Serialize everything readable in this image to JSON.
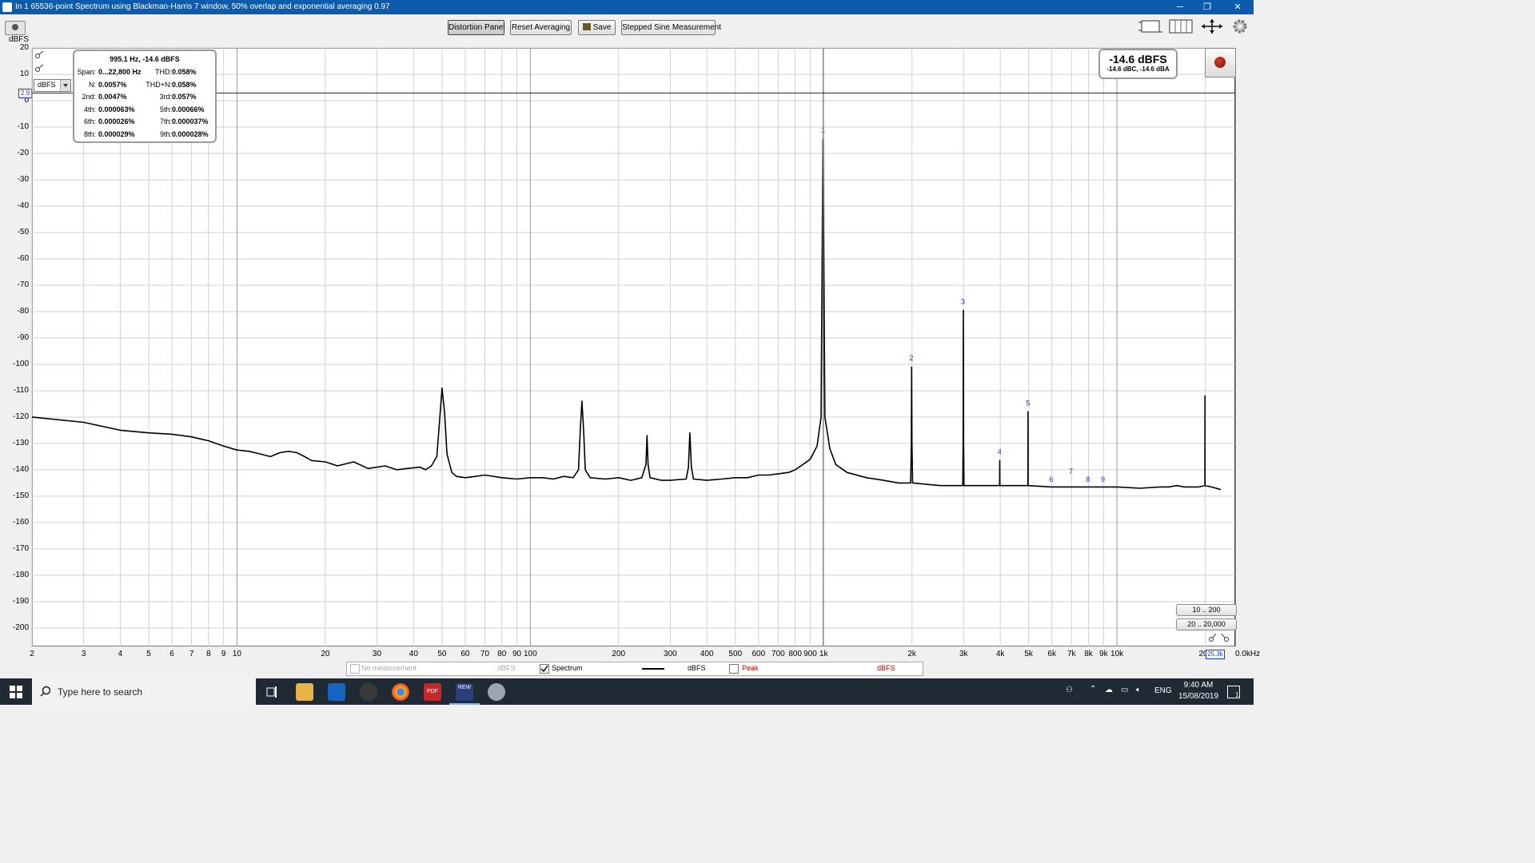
{
  "window": {
    "title": "In 1 65536-point Spectrum using Blackman-Harris 7 window, 50% overlap and exponential averaging 0.97",
    "controls": {
      "minimize": "─",
      "maximize": "❐",
      "close": "✕"
    }
  },
  "toolbar": {
    "buttons": {
      "distortion_panel": "Distortion Panel",
      "reset_averaging": "Reset Averaging",
      "save": "Save",
      "stepped_sine": "Stepped Sine Measurement"
    }
  },
  "distortion_panel": {
    "header": "995.1 Hz, -14.6 dBFS",
    "rows": [
      {
        "k1": "Span:",
        "v1": "0...22,800 Hz",
        "k2": "THD:",
        "v2": "0.058%"
      },
      {
        "k1": "N:",
        "v1": "0.0057%",
        "k2": "THD+N:",
        "v2": "0.058%"
      },
      {
        "k1": "2nd:",
        "v1": "0.0047%",
        "k2": "3rd:",
        "v2": "0.057%"
      },
      {
        "k1": "4th:",
        "v1": "0.000063%",
        "k2": "5th:",
        "v2": "0.00066%"
      },
      {
        "k1": "6th:",
        "v1": "0.000026%",
        "k2": "7th:",
        "v2": "0.000037%"
      },
      {
        "k1": "8th:",
        "v1": "0.000029%",
        "k2": "9th:",
        "v2": "0.000028%"
      }
    ]
  },
  "level_meter": {
    "main": "-14.6 dBFS",
    "sub": "-14.6 dBC, -14.6 dBA"
  },
  "y_axis": {
    "unit_label": "dBFS",
    "unit_select": "dBFS",
    "cursor_value": "2.9",
    "labels": [
      "20",
      "10",
      "0",
      "-10",
      "-20",
      "-30",
      "-40",
      "-50",
      "-60",
      "-70",
      "-80",
      "-90",
      "-100",
      "-110",
      "-120",
      "-130",
      "-140",
      "-150",
      "-160",
      "-170",
      "-180",
      "-190",
      "-200"
    ]
  },
  "x_axis": {
    "labels": [
      "2",
      "3",
      "4",
      "5",
      "6",
      "7",
      "8",
      "9",
      "10",
      "20",
      "30",
      "40",
      "50",
      "60",
      "70",
      "80",
      "90",
      "100",
      "200",
      "300",
      "400",
      "500",
      "600",
      "700",
      "800",
      "900",
      "1k",
      "2k",
      "3k",
      "4k",
      "5k",
      "6k",
      "7k",
      "8k",
      "9k",
      "10k",
      "20k"
    ],
    "cursor_value": "25.3k",
    "end_label": "0.0kHz"
  },
  "range_buttons": {
    "narrow": "10 .. 200",
    "wide": "20 .. 20,000"
  },
  "legend": {
    "no_measurement": "No measurement",
    "no_measurement_unit": "dBFS",
    "spectrum": "Spectrum",
    "spectrum_unit": "dBFS",
    "peak": "Peak",
    "peak_unit": "dBFS"
  },
  "taskbar": {
    "search_placeholder": "Type here to search",
    "language": "ENG",
    "time": "9:40 AM",
    "date": "15/08/2019",
    "notification_count": "1",
    "app_labels": {
      "pdf": "PDF",
      "rew": "REW"
    }
  },
  "colors": {
    "titlebar": "#0b5cad",
    "trace": "#000000",
    "harmonic_labels": "#1a35c9",
    "peak_legend": "#c00000",
    "taskbar": "#1f2a35"
  },
  "chart_data": {
    "type": "line",
    "x_scale": "log",
    "xlim": [
      2,
      25300
    ],
    "ylim": [
      -207,
      20
    ],
    "y_unit": "dBFS",
    "series": [
      {
        "name": "Spectrum",
        "points": [
          [
            2,
            -120
          ],
          [
            3,
            -122
          ],
          [
            4,
            -125
          ],
          [
            5,
            -126
          ],
          [
            6,
            -126.5
          ],
          [
            7,
            -127.5
          ],
          [
            8,
            -129
          ],
          [
            9,
            -131
          ],
          [
            10,
            -132.5
          ],
          [
            11,
            -133
          ],
          [
            12,
            -134
          ],
          [
            13,
            -135
          ],
          [
            14,
            -133.5
          ],
          [
            15,
            -133
          ],
          [
            16,
            -133.5
          ],
          [
            17,
            -135
          ],
          [
            18,
            -136.5
          ],
          [
            20,
            -137
          ],
          [
            22,
            -138.5
          ],
          [
            25,
            -137
          ],
          [
            28,
            -139.5
          ],
          [
            32,
            -138.5
          ],
          [
            35,
            -140
          ],
          [
            38,
            -139.5
          ],
          [
            42,
            -139
          ],
          [
            44,
            -140
          ],
          [
            46,
            -138.5
          ],
          [
            48,
            -135
          ],
          [
            49,
            -122
          ],
          [
            50,
            -109
          ],
          [
            51,
            -118
          ],
          [
            52,
            -134
          ],
          [
            54,
            -141
          ],
          [
            56,
            -142.5
          ],
          [
            60,
            -143
          ],
          [
            65,
            -142.5
          ],
          [
            70,
            -142
          ],
          [
            80,
            -143
          ],
          [
            90,
            -143.5
          ],
          [
            100,
            -143
          ],
          [
            110,
            -143
          ],
          [
            120,
            -143.5
          ],
          [
            130,
            -142.5
          ],
          [
            140,
            -143
          ],
          [
            146,
            -140
          ],
          [
            148,
            -125
          ],
          [
            150,
            -114
          ],
          [
            152,
            -125
          ],
          [
            154,
            -140
          ],
          [
            160,
            -143
          ],
          [
            180,
            -143.5
          ],
          [
            200,
            -143
          ],
          [
            220,
            -144
          ],
          [
            240,
            -143
          ],
          [
            248,
            -138
          ],
          [
            250,
            -127
          ],
          [
            252,
            -138
          ],
          [
            256,
            -143
          ],
          [
            280,
            -144
          ],
          [
            300,
            -144
          ],
          [
            340,
            -143.5
          ],
          [
            346,
            -139
          ],
          [
            350,
            -126
          ],
          [
            354,
            -139
          ],
          [
            360,
            -143.5
          ],
          [
            400,
            -144
          ],
          [
            450,
            -143.5
          ],
          [
            500,
            -143
          ],
          [
            550,
            -143
          ],
          [
            600,
            -142
          ],
          [
            650,
            -142
          ],
          [
            700,
            -141.5
          ],
          [
            760,
            -141
          ],
          [
            800,
            -140
          ],
          [
            850,
            -138
          ],
          [
            900,
            -136
          ],
          [
            950,
            -131
          ],
          [
            980,
            -120
          ],
          [
            995,
            -14.6
          ],
          [
            1010,
            -120
          ],
          [
            1050,
            -132
          ],
          [
            1100,
            -138
          ],
          [
            1200,
            -141
          ],
          [
            1400,
            -143
          ],
          [
            1600,
            -144
          ],
          [
            1800,
            -145
          ],
          [
            1980,
            -145
          ],
          [
            1990,
            -130
          ],
          [
            1995,
            -101
          ],
          [
            2000,
            -130
          ],
          [
            2010,
            -145
          ],
          [
            2500,
            -146
          ],
          [
            2980,
            -146
          ],
          [
            2990,
            -130
          ],
          [
            2995,
            -79.5
          ],
          [
            3000,
            -130
          ],
          [
            3010,
            -146
          ],
          [
            3980,
            -146
          ],
          [
            3985,
            -136.5
          ],
          [
            3990,
            -146
          ],
          [
            4970,
            -146
          ],
          [
            4975,
            -118
          ],
          [
            4980,
            -146
          ],
          [
            6000,
            -146.5
          ],
          [
            7000,
            -146.5
          ],
          [
            8000,
            -146.5
          ],
          [
            9000,
            -146.5
          ],
          [
            10000,
            -146.5
          ],
          [
            12000,
            -147
          ],
          [
            14000,
            -146.5
          ],
          [
            15000,
            -146.5
          ],
          [
            16000,
            -146
          ],
          [
            17000,
            -146.5
          ],
          [
            19000,
            -146.5
          ],
          [
            19950,
            -146
          ],
          [
            19960,
            -112
          ],
          [
            19970,
            -146
          ],
          [
            21000,
            -146.5
          ],
          [
            22600,
            -147.5
          ]
        ]
      }
    ],
    "harmonic_markers": [
      {
        "label": "1",
        "x": 995,
        "y": -14.6
      },
      {
        "label": "2",
        "x": 1990,
        "y": -101
      },
      {
        "label": "3",
        "x": 2985,
        "y": -79.5
      },
      {
        "label": "4",
        "x": 3980,
        "y": -136.5
      },
      {
        "label": "5",
        "x": 4975,
        "y": -118
      },
      {
        "label": "6",
        "x": 5970,
        "y": -147
      },
      {
        "label": "7",
        "x": 6965,
        "y": -144
      },
      {
        "label": "8",
        "x": 7960,
        "y": -147
      },
      {
        "label": "9",
        "x": 8955,
        "y": -147
      }
    ]
  }
}
